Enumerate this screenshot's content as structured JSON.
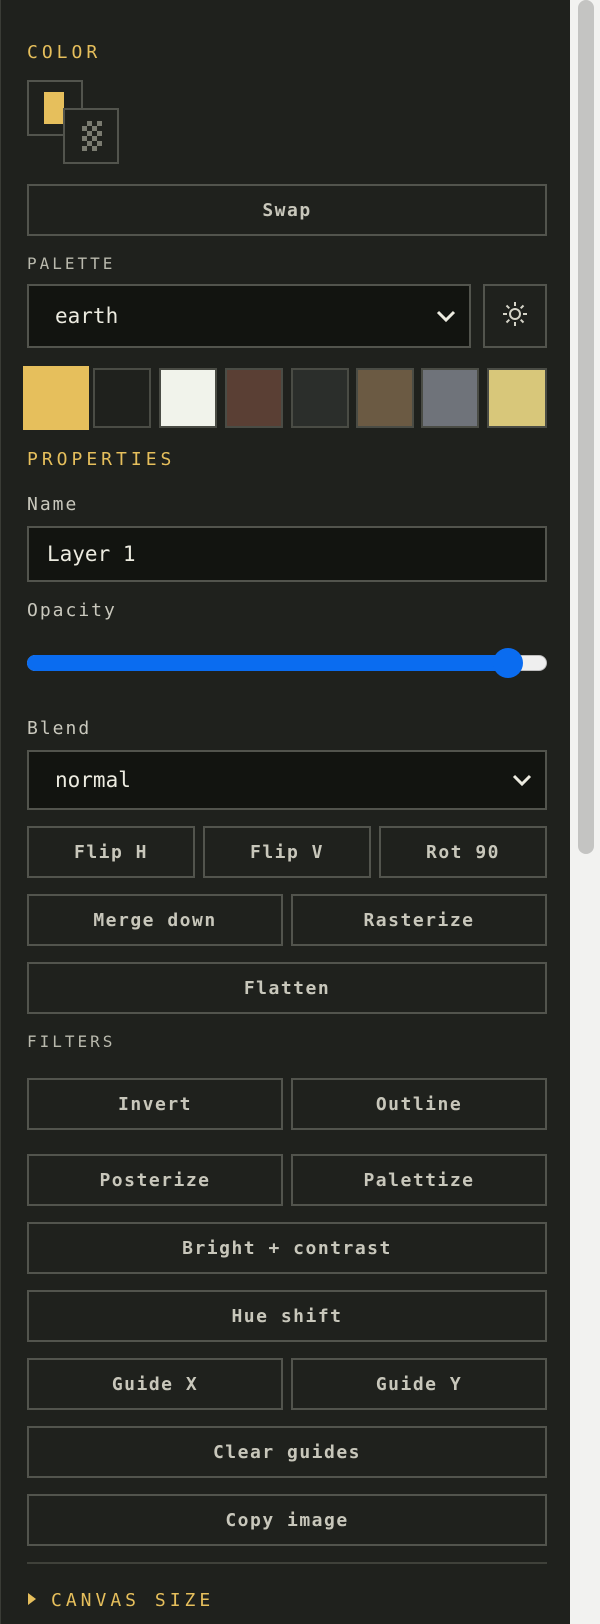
{
  "color": {
    "title": "COLOR",
    "primary": "#e6bf5c",
    "swap_label": "Swap"
  },
  "palette": {
    "title": "PALETTE",
    "selected": "earth",
    "swatches": [
      "#e6bf5c",
      "#1f211d",
      "#f1f3eb",
      "#5a3f34",
      "#2b2e2b",
      "#6b5a43",
      "#6f737a",
      "#d8c77a"
    ],
    "active_index": 0,
    "settings_icon": "sun-gear-icon"
  },
  "properties": {
    "title": "PROPERTIES",
    "name_label": "Name",
    "name_value": "Layer 1",
    "opacity_label": "Opacity",
    "opacity_fraction": 0.95,
    "blend_label": "Blend",
    "blend_value": "normal",
    "buttons": {
      "flip_h": "Flip H",
      "flip_v": "Flip V",
      "rot_90": "Rot 90",
      "merge_down": "Merge down",
      "rasterize": "Rasterize",
      "flatten": "Flatten"
    }
  },
  "filters": {
    "title": "FILTERS",
    "buttons": {
      "invert": "Invert",
      "outline": "Outline",
      "posterize": "Posterize",
      "palettize": "Palettize",
      "bright_contrast": "Bright + contrast",
      "hue_shift": "Hue shift",
      "guide_x": "Guide X",
      "guide_y": "Guide Y",
      "clear_guides": "Clear guides",
      "copy_image": "Copy image"
    }
  },
  "canvas_size": {
    "title": "CANVAS SIZE"
  },
  "colors": {
    "accent": "#e6bf5c",
    "slider_blue": "#0a6cf0",
    "panel_bg": "#1f211d"
  }
}
